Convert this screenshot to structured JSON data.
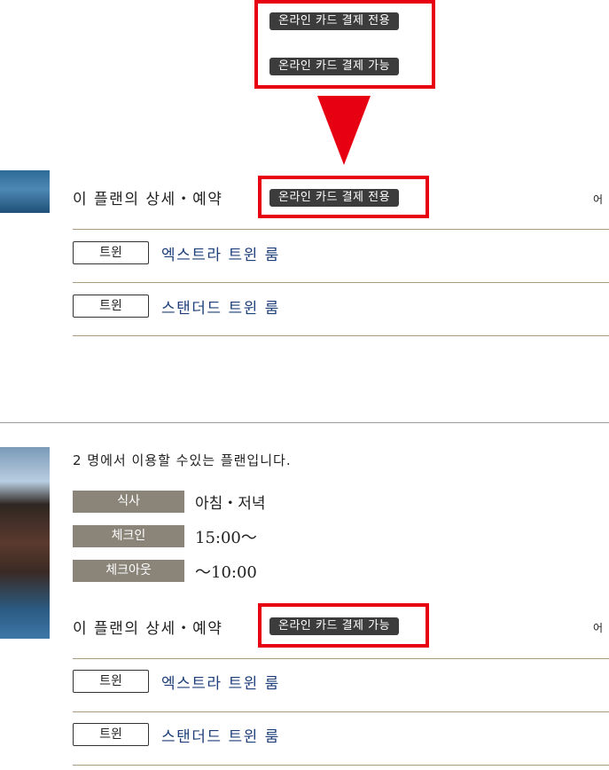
{
  "callout": {
    "badge_exclusive": "온라인 카드 결제 전용",
    "badge_available": "온라인 카드 결제 가능"
  },
  "plan1": {
    "details_label": "이 플랜의 상세・예약",
    "badge": "온라인 카드 결제 전용",
    "right_cut_text": "어",
    "rooms": [
      {
        "tag": "트윈",
        "name": "엑스트라 트윈 룸"
      },
      {
        "tag": "트윈",
        "name": "스탠더드 트윈 룸"
      }
    ]
  },
  "plan2": {
    "description": "2 명에서 이용할 수있는 플랜입니다.",
    "info": [
      {
        "label": "식사",
        "value": "아침・저녁"
      },
      {
        "label": "체크인",
        "value": "15:00〜"
      },
      {
        "label": "체크아웃",
        "value": "〜10:00"
      }
    ],
    "details_label": "이 플랜의 상세・예약",
    "badge": "온라인 카드 결제 가능",
    "right_cut_text": "어",
    "rooms": [
      {
        "tag": "트윈",
        "name": "엑스트라 트윈 룸"
      },
      {
        "tag": "트윈",
        "name": "스탠더드 트윈 룸"
      }
    ]
  },
  "colors": {
    "highlight_red": "#e60012",
    "badge_dark": "#3c3c3c",
    "link_blue": "#1e3f7a",
    "info_label_bg": "#8a8479",
    "divider": "#a89c7c"
  }
}
